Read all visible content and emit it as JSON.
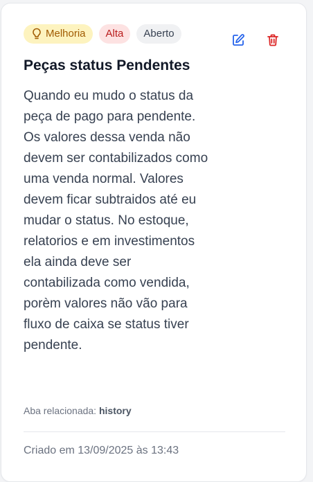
{
  "card": {
    "tags": {
      "type": "Melhoria",
      "priority": "Alta",
      "status": "Aberto"
    },
    "icons": {
      "type": "lightbulb-icon",
      "edit": "edit-icon",
      "delete": "trash-icon"
    },
    "title": "Peças status Pendentes",
    "description": "Quando eu mudo o status da peça de pago para pendente. Os valores dessa venda não devem ser contabilizados como uma venda normal. Valores devem ficar subtraidos até eu mudar o status. No estoque, relatorios e em investimentos ela ainda deve ser contabilizada como vendida, porèm valores não vão para fluxo de caixa se status tiver pendente.",
    "related_label": "Aba relacionada:",
    "related_value": "history",
    "created": "Criado em 13/09/2025 às 13:43"
  },
  "colors": {
    "type_bg": "#fdf3bf",
    "type_text": "#a05a00",
    "priority_bg": "#fde2e2",
    "priority_text": "#b91c1c",
    "status_bg": "#f0f1f3",
    "edit_icon": "#2563eb",
    "delete_icon": "#dc2626"
  }
}
